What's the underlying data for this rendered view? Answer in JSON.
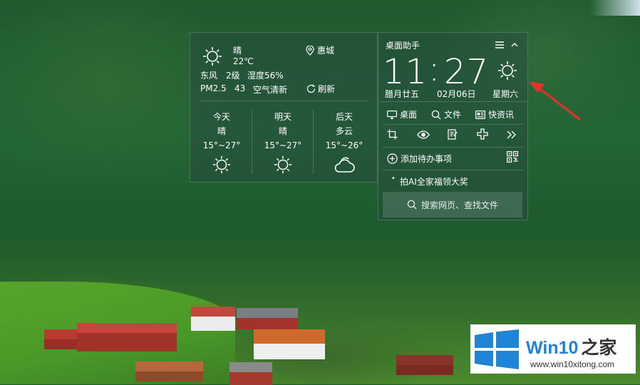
{
  "weather": {
    "condition": "晴",
    "temperature": "22℃",
    "location": "惠城",
    "wind_dir": "东风",
    "wind_level": "2级",
    "humidity": "湿度56%",
    "pm_label": "PM2.5",
    "pm_value": "43",
    "air": "空气清新",
    "refresh": "刷新",
    "forecast": [
      {
        "day": "今天",
        "condition": "晴",
        "range": "15°~27°",
        "icon": "sun-icon"
      },
      {
        "day": "明天",
        "condition": "晴",
        "range": "15°~27°",
        "icon": "sun-icon"
      },
      {
        "day": "后天",
        "condition": "多云",
        "range": "15°~26°",
        "icon": "cloud-icon"
      }
    ]
  },
  "assistant": {
    "title": "桌面助手",
    "hour": "11",
    "minute": "27",
    "lunar": "腊月廿五",
    "date": "02月06日",
    "weekday": "星期六",
    "tools": {
      "desktop": "桌面",
      "file": "文件",
      "news": "快资讯"
    },
    "todo": "添加待办事项",
    "promo": "拍AI全家福领大奖",
    "search_placeholder": "搜索网页、查找文件"
  },
  "watermark": {
    "brand": "Win10",
    "brand_suffix": "之家",
    "url": "www.win10xitong.com"
  },
  "colors": {
    "annotation_arrow": "#e8302a",
    "brand_blue": "#1f84d6"
  }
}
